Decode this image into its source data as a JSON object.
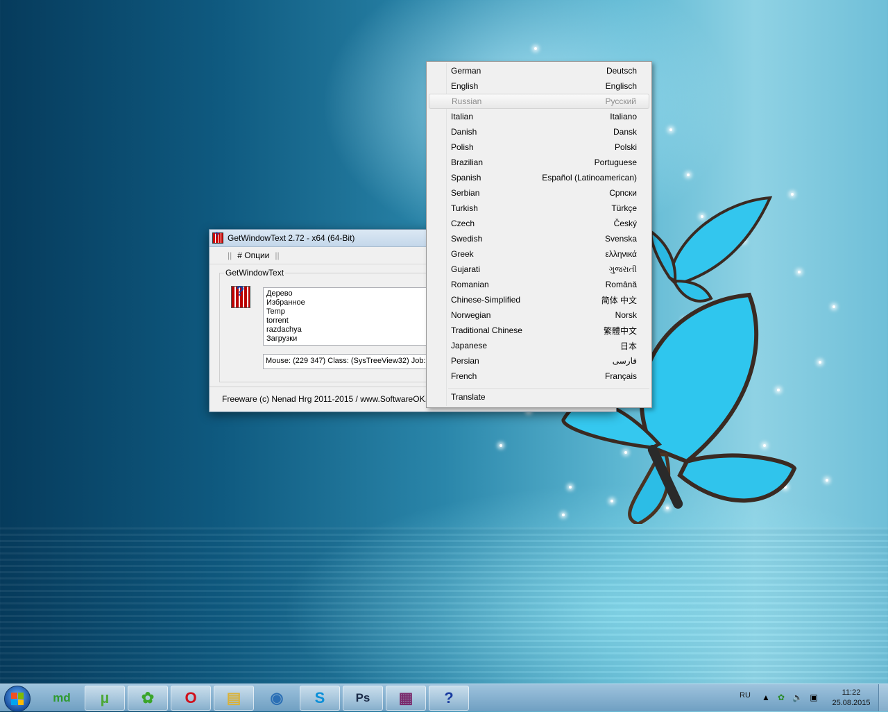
{
  "window": {
    "title": "GetWindowText 2.72 - x64 (64-Bit)",
    "menu_sep1": "||",
    "menu_options": "# Опции",
    "menu_sep2": "||",
    "group_label": "GetWindowText",
    "tree_items": [
      "Дерево",
      "Избранное",
      "Temp",
      "torrent",
      "razdachya",
      "Загрузки"
    ],
    "status_text": "Mouse: (229 347) Class: (SysTreeView32) Job:(24",
    "footer": "Freeware (c) Nenad Hrg 2011-2015 / www.SoftwareOK.com"
  },
  "language_menu": {
    "items": [
      {
        "left": "German",
        "right": "Deutsch"
      },
      {
        "left": "English",
        "right": "Englisch"
      },
      {
        "left": "Russian",
        "right": "Русский",
        "disabled": true
      },
      {
        "left": "Italian",
        "right": "Italiano"
      },
      {
        "left": "Danish",
        "right": "Dansk"
      },
      {
        "left": "Polish",
        "right": "Polski"
      },
      {
        "left": "Brazilian",
        "right": "Portuguese"
      },
      {
        "left": "Spanish",
        "right": "Español (Latinoamerican)"
      },
      {
        "left": "Serbian",
        "right": "Српски"
      },
      {
        "left": "Turkish",
        "right": "Türkçe"
      },
      {
        "left": "Czech",
        "right": "Český"
      },
      {
        "left": "Swedish",
        "right": "Svenska"
      },
      {
        "left": "Greek",
        "right": "ελληνικά"
      },
      {
        "left": "Gujarati",
        "right": "ગુજરાતી"
      },
      {
        "left": "Romanian",
        "right": "Română"
      },
      {
        "left": "Chinese-Simplified",
        "right": "简体 中文"
      },
      {
        "left": "Norwegian",
        "right": "Norsk"
      },
      {
        "left": "Traditional Chinese",
        "right": "繁體中文"
      },
      {
        "left": "Japanese",
        "right": "日本"
      },
      {
        "left": "Persian",
        "right": "فارسی"
      },
      {
        "left": "French",
        "right": "Français"
      }
    ],
    "translate": "Translate"
  },
  "taskbar": {
    "apps": [
      {
        "name": "mydocs",
        "label": "md",
        "color": "#2e9a2e"
      },
      {
        "name": "utorrent",
        "label": "µ",
        "color": "#4da838"
      },
      {
        "name": "icq",
        "label": "✿",
        "color": "#3aa52a"
      },
      {
        "name": "opera",
        "label": "O",
        "color": "#d0101b"
      },
      {
        "name": "explorer",
        "label": "▤",
        "color": "#d9b23a"
      },
      {
        "name": "qip",
        "label": "◉",
        "color": "#2b6fb5"
      },
      {
        "name": "skype",
        "label": "S",
        "color": "#0a8fd8"
      },
      {
        "name": "photoshop",
        "label": "Ps",
        "color": "#1b2b48"
      },
      {
        "name": "winrar",
        "label": "▦",
        "color": "#7a2a6c"
      },
      {
        "name": "getwindowtext",
        "label": "?",
        "color": "#1a3ca0"
      }
    ],
    "lang": "RU",
    "time": "11:22",
    "date": "25.08.2015"
  }
}
